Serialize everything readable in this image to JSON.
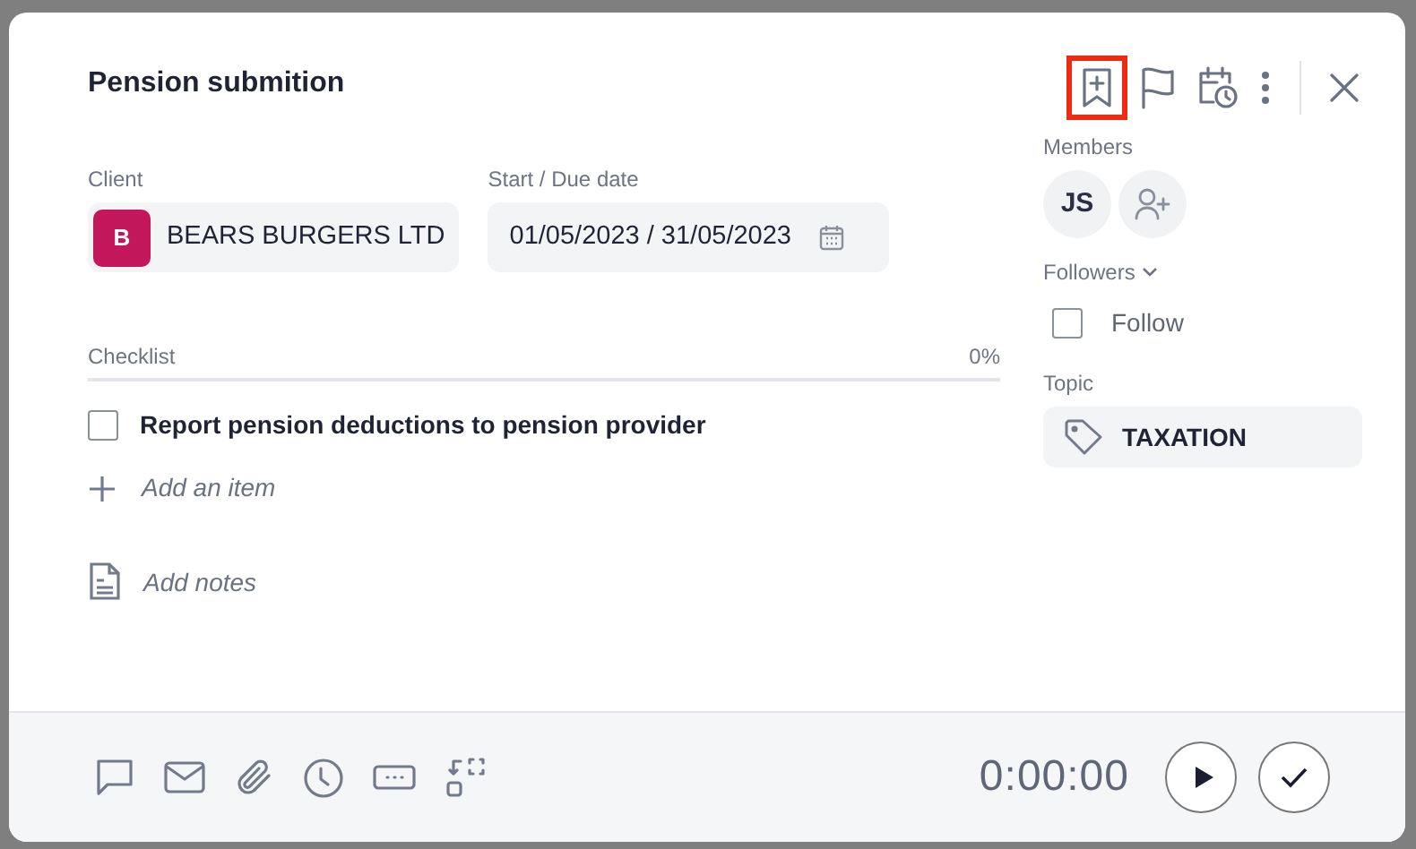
{
  "dialog": {
    "title": "Pension submition",
    "header_actions": [
      {
        "kind": "bookmark-add",
        "highlighted": true
      },
      {
        "kind": "flag",
        "highlighted": false
      },
      {
        "kind": "schedule",
        "highlighted": false
      },
      {
        "kind": "more",
        "highlighted": false
      },
      {
        "kind": "close",
        "highlighted": false
      }
    ],
    "client": {
      "label": "Client",
      "initial": "B",
      "name": "BEARS BURGERS LTD"
    },
    "due_date": {
      "label": "Start / Due date",
      "value": "01/05/2023 / 31/05/2023"
    },
    "checklist": {
      "label": "Checklist",
      "progress": "0%",
      "level": 0,
      "items": [
        {
          "text": "Report pension deductions to pension provider",
          "checked": false
        }
      ],
      "add_item": "Add an item"
    },
    "add_notes": "Add notes",
    "members": {
      "label": "Members",
      "items": [
        "JS"
      ]
    },
    "followers": {
      "label": "Followers",
      "follow": {
        "label": "Follow",
        "checked": false
      }
    },
    "topic": {
      "label": "Topic",
      "value": "TAXATION"
    },
    "footer": {
      "tools": [
        {
          "kind": "comment"
        },
        {
          "kind": "mail"
        },
        {
          "kind": "attachment"
        },
        {
          "kind": "clock"
        },
        {
          "kind": "more-box"
        },
        {
          "kind": "convert"
        }
      ],
      "timer": "0:00:00",
      "actions": [
        {
          "kind": "play"
        },
        {
          "kind": "done"
        }
      ]
    }
  }
}
